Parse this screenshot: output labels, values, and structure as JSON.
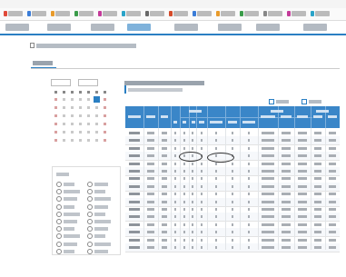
{
  "browser": {
    "address_text": "",
    "bookmark_count": 14
  },
  "site_nav": {
    "items": [
      "",
      "",
      "",
      "",
      "",
      "",
      "",
      ""
    ],
    "active_index": 3
  },
  "breadcrumb": "",
  "active_tab": "",
  "calendar": {
    "year_value": "",
    "month_value": "",
    "weeks": 6,
    "days_per_week": 7
  },
  "filter_list": {
    "items": [
      "",
      "",
      "",
      "",
      "",
      "",
      "",
      "",
      "",
      "",
      "",
      "",
      "",
      "",
      "",
      "",
      "",
      "",
      "",
      ""
    ]
  },
  "report": {
    "title": "",
    "subtitle": "",
    "table_rows": 16
  },
  "colors": {
    "accent": "#2a7fc3",
    "table_header": "#3a86c8",
    "nav_underline": "#2a7fc3"
  }
}
